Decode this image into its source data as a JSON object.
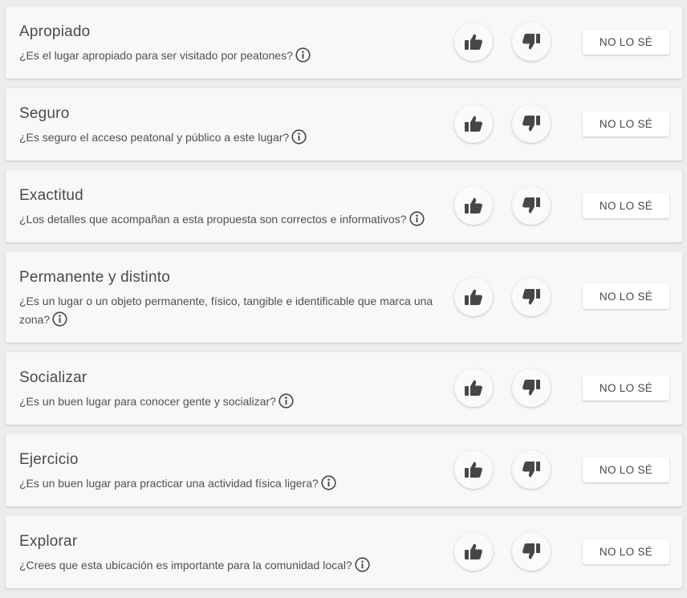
{
  "criteria": [
    {
      "title": "Apropiado",
      "question": "¿Es el lugar apropiado para ser visitado por peatones?",
      "unknown_label": "NO LO SÉ"
    },
    {
      "title": "Seguro",
      "question": "¿Es seguro el acceso peatonal y público a este lugar?",
      "unknown_label": "NO LO SÉ"
    },
    {
      "title": "Exactitud",
      "question": "¿Los detalles que acompañan a esta propuesta son correctos e informativos?",
      "unknown_label": "NO LO SÉ"
    },
    {
      "title": "Permanente y distinto",
      "question": "¿Es un lugar o un objeto permanente, físico, tangible e identificable que marca una zona?",
      "unknown_label": "NO LO SÉ"
    },
    {
      "title": "Socializar",
      "question": "¿Es un buen lugar para conocer gente y socializar?",
      "unknown_label": "NO LO SÉ"
    },
    {
      "title": "Ejercicio",
      "question": "¿Es un buen lugar para practicar una actividad física ligera?",
      "unknown_label": "NO LO SÉ"
    },
    {
      "title": "Explorar",
      "question": "¿Crees que esta ubicación es importante para la comunidad local?",
      "unknown_label": "NO LO SÉ"
    }
  ],
  "icons": {
    "thumbs_up": "thumbs-up-icon",
    "thumbs_down": "thumbs-down-icon",
    "info": "info-icon"
  },
  "colors": {
    "icon": "#464646",
    "card_background": "#f8f8f8",
    "page_background": "#ececec"
  }
}
